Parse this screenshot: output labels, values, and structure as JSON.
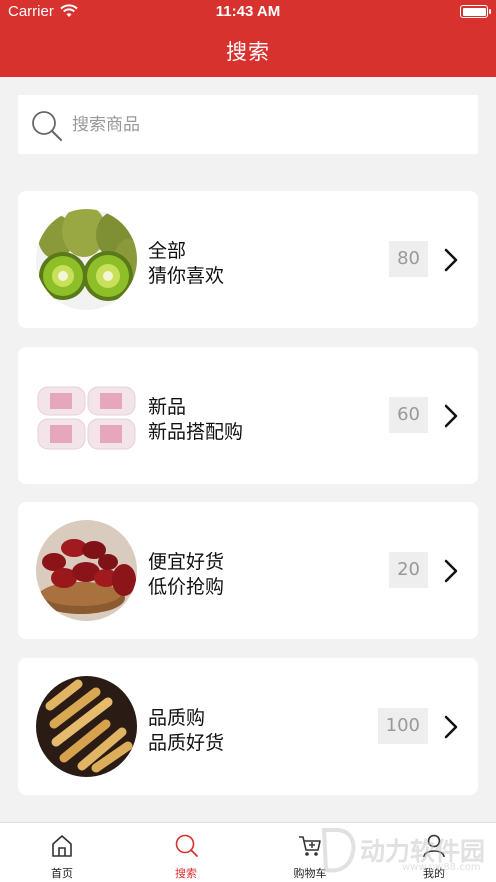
{
  "status_bar": {
    "carrier": "Carrier",
    "time": "11:43 AM"
  },
  "header": {
    "title": "搜索"
  },
  "search": {
    "placeholder": "搜索商品"
  },
  "colors": {
    "accent": "#d8322f",
    "background": "#f2f2f2"
  },
  "categories": [
    {
      "title": "全部",
      "subtitle": "猜你喜欢",
      "count": "80",
      "image": "kiwi-fruit-image"
    },
    {
      "title": "新品",
      "subtitle": "新品搭配购",
      "count": "60",
      "image": "pink-packaged-products-image"
    },
    {
      "title": "便宜好货",
      "subtitle": "低价抢购",
      "count": "20",
      "image": "red-dates-image"
    },
    {
      "title": "品质购",
      "subtitle": "品质好货",
      "count": "100",
      "image": "egg-roll-snacks-image"
    }
  ],
  "tabbar": {
    "items": [
      {
        "label": "首页",
        "icon": "home-icon"
      },
      {
        "label": "搜索",
        "icon": "search-icon",
        "active": true
      },
      {
        "label": "购物车",
        "icon": "cart-icon"
      },
      {
        "label": "我的",
        "icon": "user-icon"
      }
    ]
  },
  "watermark": {
    "text": "动力软件园",
    "url": "www.pw88.com"
  }
}
